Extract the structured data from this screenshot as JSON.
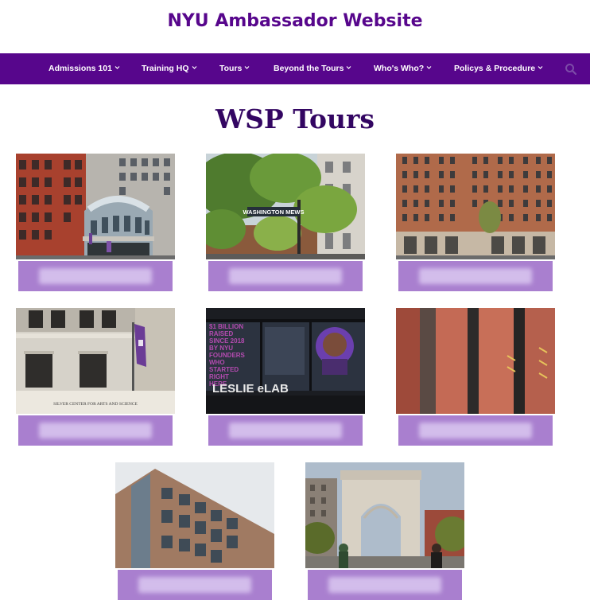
{
  "site": {
    "title": "NYU Ambassador Website"
  },
  "nav": {
    "items": [
      {
        "label": "Admissions 101"
      },
      {
        "label": "Training HQ"
      },
      {
        "label": "Tours"
      },
      {
        "label": "Beyond the Tours"
      },
      {
        "label": "Who's Who?"
      },
      {
        "label": "Policys & Procedure"
      }
    ],
    "search_icon": "search-icon"
  },
  "page": {
    "title": "WSP Tours"
  },
  "colors": {
    "brand_purple": "#57068c",
    "title_purple": "#330662",
    "label_purple": "#a97fcf"
  },
  "photo_texts": {
    "street_sign": "WASHINGTON MEWS",
    "window_lines": [
      "$1 BILLION",
      "RAISED",
      "SINCE 2018",
      "BY NYU",
      "FOUNDERS",
      "WHO",
      "STARTED",
      "RIGHT",
      "HERE"
    ],
    "window_sign": "LESLIE eLAB",
    "building_inscription": "SILVER CENTER FOR ARTS AND SCIENCE"
  }
}
